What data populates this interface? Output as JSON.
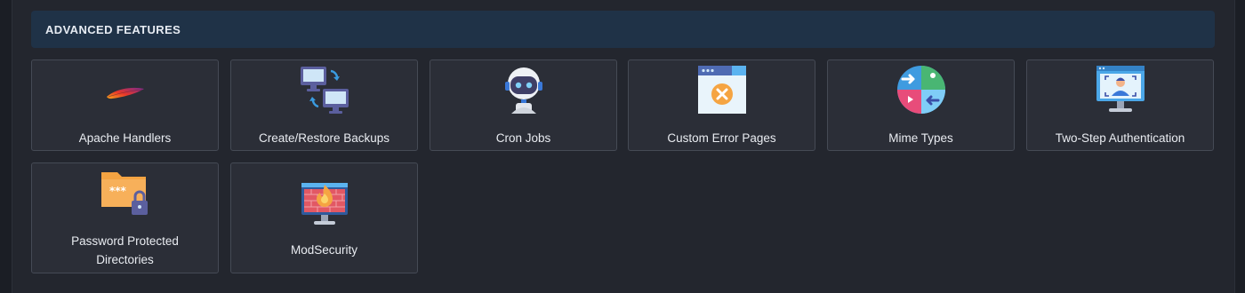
{
  "section": {
    "title": "ADVANCED FEATURES"
  },
  "items": [
    {
      "label": "Apache Handlers",
      "icon": "apache-feather-icon"
    },
    {
      "label": "Create/Restore Backups",
      "icon": "backup-monitors-icon"
    },
    {
      "label": "Cron Jobs",
      "icon": "robot-icon"
    },
    {
      "label": "Custom Error Pages",
      "icon": "error-window-icon"
    },
    {
      "label": "Mime Types",
      "icon": "mime-globe-icon"
    },
    {
      "label": "Two-Step Authentication",
      "icon": "face-auth-monitor-icon"
    },
    {
      "label": "Password Protected Directories",
      "icon": "locked-folder-icon"
    },
    {
      "label": "ModSecurity",
      "icon": "firewall-monitor-icon"
    }
  ],
  "colors": {
    "panel": "#23262e",
    "header": "#1f3247",
    "tile": "#2b2e37",
    "tile_border": "#454a55"
  }
}
